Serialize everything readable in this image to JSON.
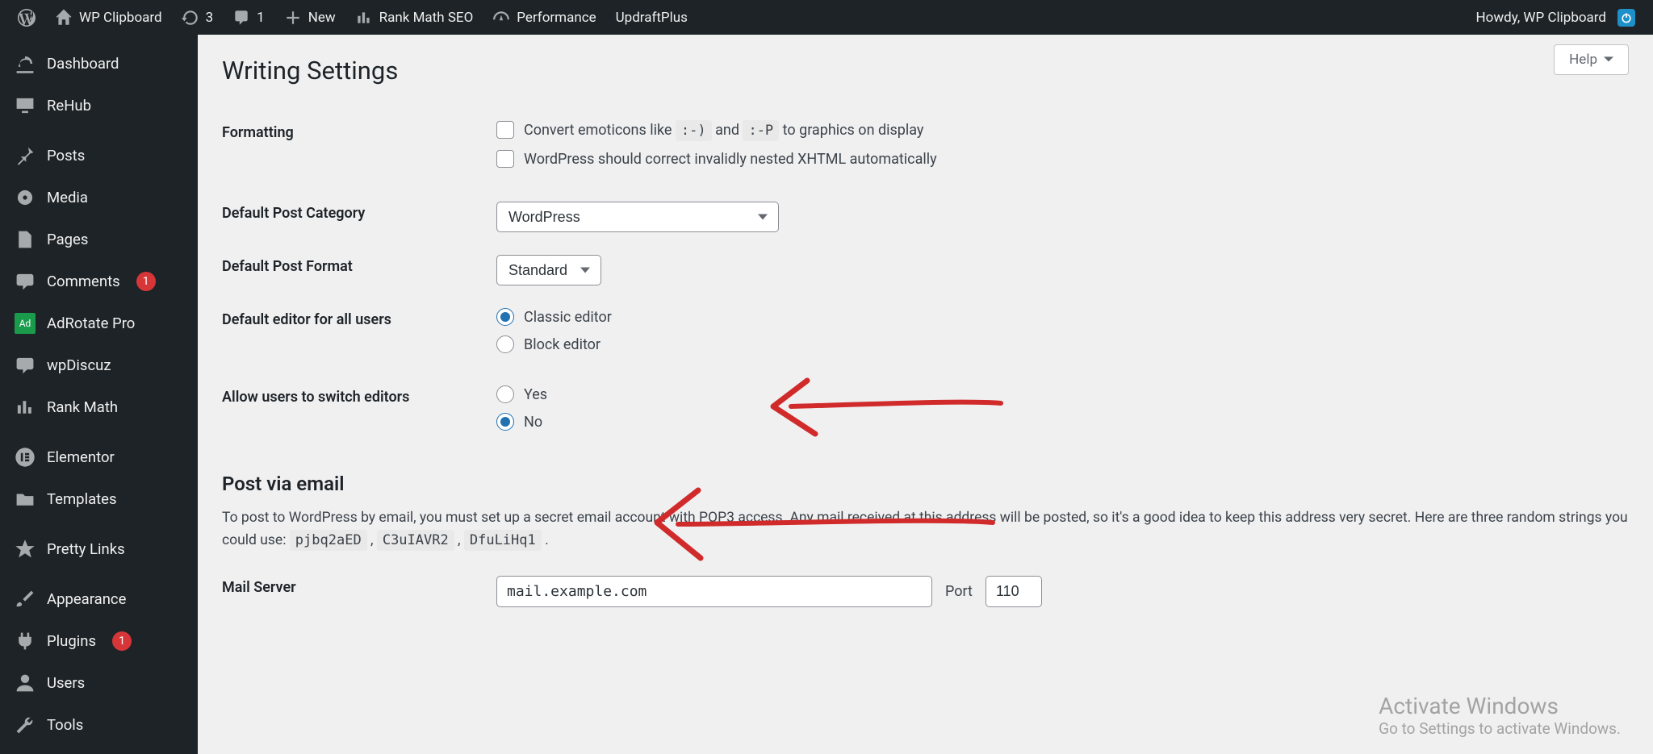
{
  "adminbar": {
    "site_name": "WP Clipboard",
    "updates": "3",
    "comments": "1",
    "new": "New",
    "rankmath": "Rank Math SEO",
    "performance": "Performance",
    "updraft": "UpdraftPlus",
    "howdy": "Howdy, WP Clipboard"
  },
  "sidebar": {
    "dashboard": "Dashboard",
    "rehub": "ReHub",
    "posts": "Posts",
    "media": "Media",
    "pages": "Pages",
    "comments": "Comments",
    "comments_count": "1",
    "adrotate": "AdRotate Pro",
    "adrotate_badge": "Ad",
    "wpdiscuz": "wpDiscuz",
    "rankmath": "Rank Math",
    "elementor": "Elementor",
    "templates": "Templates",
    "prettylinks": "Pretty Links",
    "appearance": "Appearance",
    "plugins": "Plugins",
    "plugins_count": "1",
    "users": "Users",
    "tools": "Tools"
  },
  "page": {
    "help": "Help",
    "title": "Writing Settings",
    "formatting_label": "Formatting",
    "convert_emoticons_pre": "Convert emoticons like ",
    "emoticon1": ":-)",
    "convert_emoticons_mid": " and ",
    "emoticon2": ":-P",
    "convert_emoticons_post": " to graphics on display",
    "xhtml_line": "WordPress should correct invalidly nested XHTML automatically",
    "default_category_label": "Default Post Category",
    "default_category_value": "WordPress",
    "default_format_label": "Default Post Format",
    "default_format_value": "Standard",
    "default_editor_label": "Default editor for all users",
    "editor_classic": "Classic editor",
    "editor_block": "Block editor",
    "allow_switch_label": "Allow users to switch editors",
    "switch_yes": "Yes",
    "switch_no": "No",
    "post_via_email_title": "Post via email",
    "post_via_email_desc_pre": "To post to WordPress by email, you must set up a secret email account with POP3 access. Any mail received at this address will be posted, so it's a good idea to keep this address very secret. Here are three random strings you could use: ",
    "rand1": "pjbq2aED",
    "rand_sep": " , ",
    "rand2": "C3uIAVR2",
    "rand3": "DfuLiHq1",
    "rand_end": " .",
    "mail_server_label": "Mail Server",
    "mail_server_value": "mail.example.com",
    "port_label": "Port",
    "port_value": "110"
  },
  "watermark": {
    "line1": "Activate Windows",
    "line2": "Go to Settings to activate Windows."
  }
}
